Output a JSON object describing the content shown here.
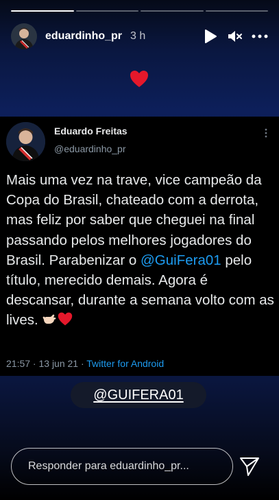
{
  "story": {
    "progress": [
      1,
      0,
      0,
      0
    ],
    "username": "eduardinho_pr",
    "time": "3 h",
    "icons": {
      "play": "play-icon",
      "mute": "mute-icon",
      "more": "more-icon",
      "heart": "heart-icon",
      "send": "send-icon"
    }
  },
  "tweet": {
    "name": "Eduardo Freitas",
    "handle": "@eduardinho_pr",
    "text_part1": "Mais uma vez na trave, vice campeão da Copa do Brasil, chateado com a derrota, mas feliz por saber que cheguei na final passando pelos melhores jogadores do Brasil. Parabenizar o ",
    "mention": "@GuiFera01",
    "text_part2": " pelo título, merecido demais. Agora é descansar, durante a semana volto com as lives. ",
    "emojis": [
      "🤙🏻",
      "❤️"
    ],
    "timestamp": "21:57 · 13 jun 21 · ",
    "source": "Twitter for Android"
  },
  "sticker": {
    "label": "@GUIFERA01"
  },
  "reply": {
    "placeholder": "Responder para eduardinho_pr..."
  },
  "colors": {
    "link": "#1d9bf0",
    "heart": "#e5182b",
    "tweet_bg": "#000000",
    "story_bg": "#0d1f5a"
  }
}
